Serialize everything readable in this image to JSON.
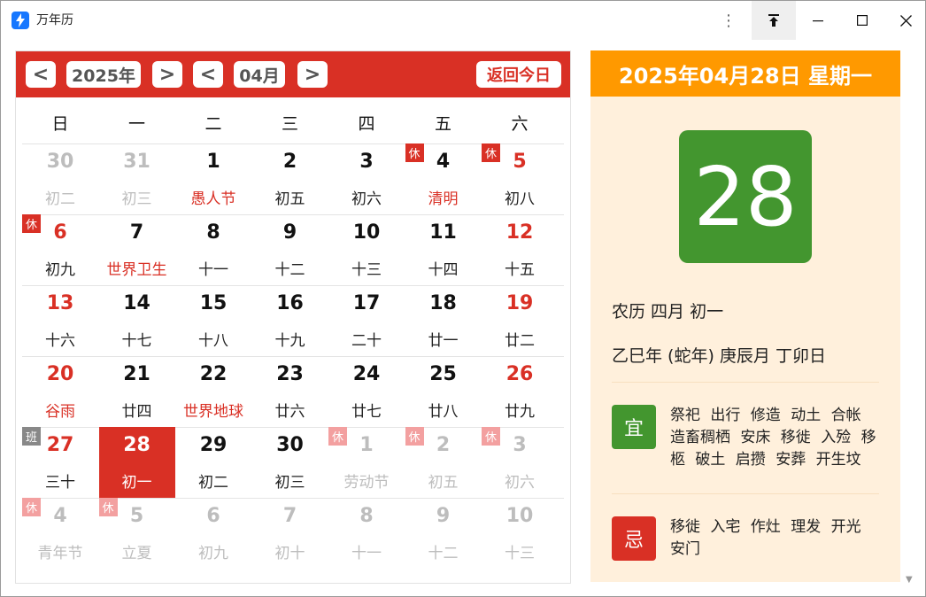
{
  "window": {
    "title": "万年历"
  },
  "nav": {
    "prev": "<",
    "next": ">",
    "year": "2025年",
    "month": "04月",
    "today_button": "返回今日"
  },
  "weekdays": [
    "日",
    "一",
    "二",
    "三",
    "四",
    "五",
    "六"
  ],
  "weeks": [
    [
      {
        "d": "30",
        "s": "初二",
        "dim": true
      },
      {
        "d": "31",
        "s": "初三",
        "dim": true
      },
      {
        "d": "1",
        "s": "愚人节",
        "hol": true
      },
      {
        "d": "2",
        "s": "初五"
      },
      {
        "d": "3",
        "s": "初六"
      },
      {
        "d": "4",
        "s": "清明",
        "hol": true,
        "badge": "休"
      },
      {
        "d": "5",
        "s": "初八",
        "wkend": true,
        "badge": "休"
      }
    ],
    [
      {
        "d": "6",
        "s": "初九",
        "wkend": true,
        "badge": "休"
      },
      {
        "d": "7",
        "s": "世界卫生",
        "hol": true
      },
      {
        "d": "8",
        "s": "十一"
      },
      {
        "d": "9",
        "s": "十二"
      },
      {
        "d": "10",
        "s": "十三"
      },
      {
        "d": "11",
        "s": "十四"
      },
      {
        "d": "12",
        "s": "十五",
        "wkend": true
      }
    ],
    [
      {
        "d": "13",
        "s": "十六",
        "wkend": true
      },
      {
        "d": "14",
        "s": "十七"
      },
      {
        "d": "15",
        "s": "十八"
      },
      {
        "d": "16",
        "s": "十九"
      },
      {
        "d": "17",
        "s": "二十"
      },
      {
        "d": "18",
        "s": "廿一"
      },
      {
        "d": "19",
        "s": "廿二",
        "wkend": true
      }
    ],
    [
      {
        "d": "20",
        "s": "谷雨",
        "wkend": true,
        "hol": true
      },
      {
        "d": "21",
        "s": "廿四"
      },
      {
        "d": "22",
        "s": "世界地球",
        "hol": true
      },
      {
        "d": "23",
        "s": "廿六"
      },
      {
        "d": "24",
        "s": "廿七"
      },
      {
        "d": "25",
        "s": "廿八"
      },
      {
        "d": "26",
        "s": "廿九",
        "wkend": true
      }
    ],
    [
      {
        "d": "27",
        "s": "三十",
        "wkend": true,
        "badge": "班",
        "badge_type": "work"
      },
      {
        "d": "28",
        "s": "初一",
        "sel": true
      },
      {
        "d": "29",
        "s": "初二"
      },
      {
        "d": "30",
        "s": "初三"
      },
      {
        "d": "1",
        "s": "劳动节",
        "dim": true,
        "badge": "休",
        "badge_type": "light"
      },
      {
        "d": "2",
        "s": "初五",
        "dim": true,
        "badge": "休",
        "badge_type": "light"
      },
      {
        "d": "3",
        "s": "初六",
        "dim": true,
        "badge": "休",
        "badge_type": "light"
      }
    ],
    [
      {
        "d": "4",
        "s": "青年节",
        "dim": true,
        "badge": "休",
        "badge_type": "light"
      },
      {
        "d": "5",
        "s": "立夏",
        "dim": true,
        "badge": "休",
        "badge_type": "light"
      },
      {
        "d": "6",
        "s": "初九",
        "dim": true
      },
      {
        "d": "7",
        "s": "初十",
        "dim": true
      },
      {
        "d": "8",
        "s": "十一",
        "dim": true
      },
      {
        "d": "9",
        "s": "十二",
        "dim": true
      },
      {
        "d": "10",
        "s": "十三",
        "dim": true
      }
    ]
  ],
  "detail": {
    "date_header": "2025年04月28日 星期一",
    "big_day": "28",
    "lunar": "农历 四月 初一",
    "ganzhi": "乙巳年 (蛇年) 庚辰月 丁卯日",
    "yi_label": "宜",
    "yi_text": "祭祀 出行 修造 动土 合帐 造畜稠栖 安床 移徙 入殓 移柩 破土 启攒 安葬 开生坟",
    "ji_label": "忌",
    "ji_text": "移徙 入宅 作灶 理发 开光 安门"
  },
  "colors": {
    "accent_red": "#d93025",
    "header_orange": "#ff9900",
    "green": "#43962f",
    "panel_bg": "#fff0dc"
  }
}
